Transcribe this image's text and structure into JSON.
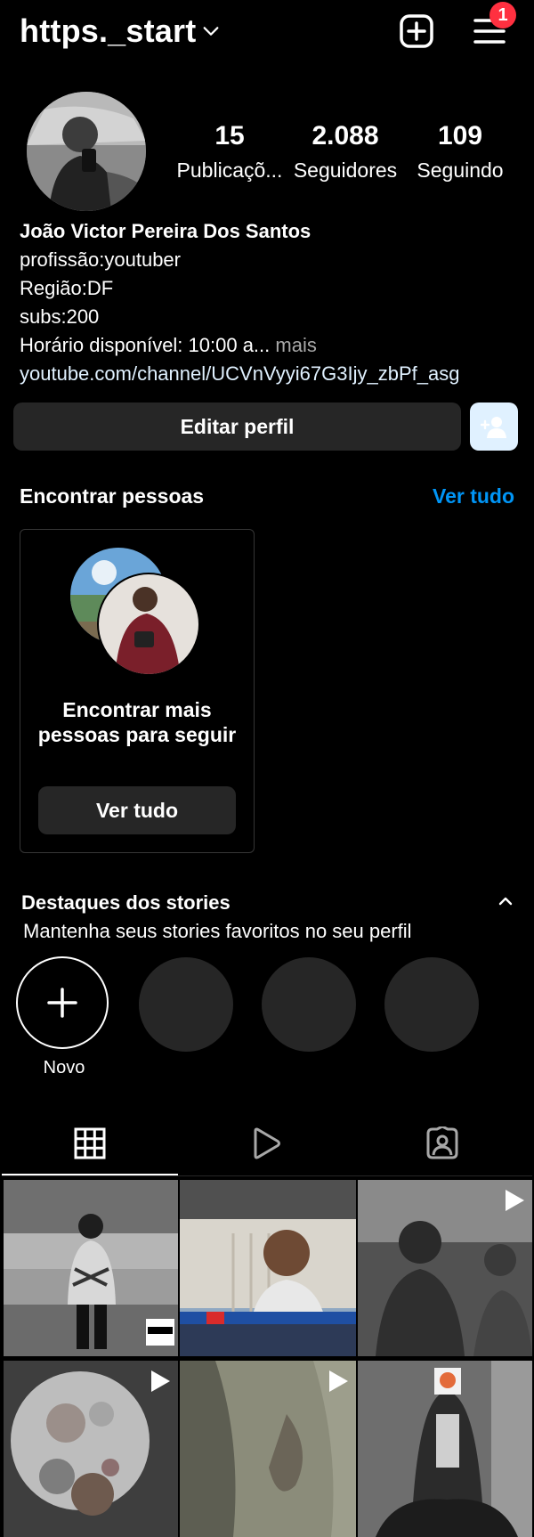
{
  "header": {
    "username": "https._start",
    "notifications_count": "1",
    "icons": [
      "chevron-down-icon",
      "plus-square-icon",
      "menu-icon"
    ]
  },
  "profile": {
    "stats": [
      {
        "value": "15",
        "label": "Publicaçõ..."
      },
      {
        "value": "2.088",
        "label": "Seguidores"
      },
      {
        "value": "109",
        "label": "Seguindo"
      }
    ],
    "name": "João Victor Pereira Dos Santos",
    "bio_lines": [
      "profissão:youtuber",
      "Região:DF",
      "subs:200"
    ],
    "bio_truncated": "Horário disponível: 10:00 a...",
    "more_label": " mais",
    "link": "youtube.com/channel/UCVnVyyi67G3Ijy_zbPf_asg"
  },
  "actions": {
    "edit_profile": "Editar perfil",
    "suggest_icon": "add-person-icon"
  },
  "find_people": {
    "title": "Encontrar pessoas",
    "see_all": "Ver tudo",
    "card_text": "Encontrar mais pessoas para seguir",
    "card_button": "Ver tudo"
  },
  "highlights": {
    "title": "Destaques dos stories",
    "subtitle": "Mantenha seus stories favoritos no seu perfil",
    "new_label": "Novo"
  },
  "tabs": {
    "icons": [
      "grid-icon",
      "reels-icon",
      "tagged-icon"
    ],
    "active": "grid-icon"
  },
  "colors": {
    "accent": "#0095f6",
    "badge": "#ff3040",
    "button_bg": "#262626",
    "suggest_bg": "#e0f1ff"
  }
}
